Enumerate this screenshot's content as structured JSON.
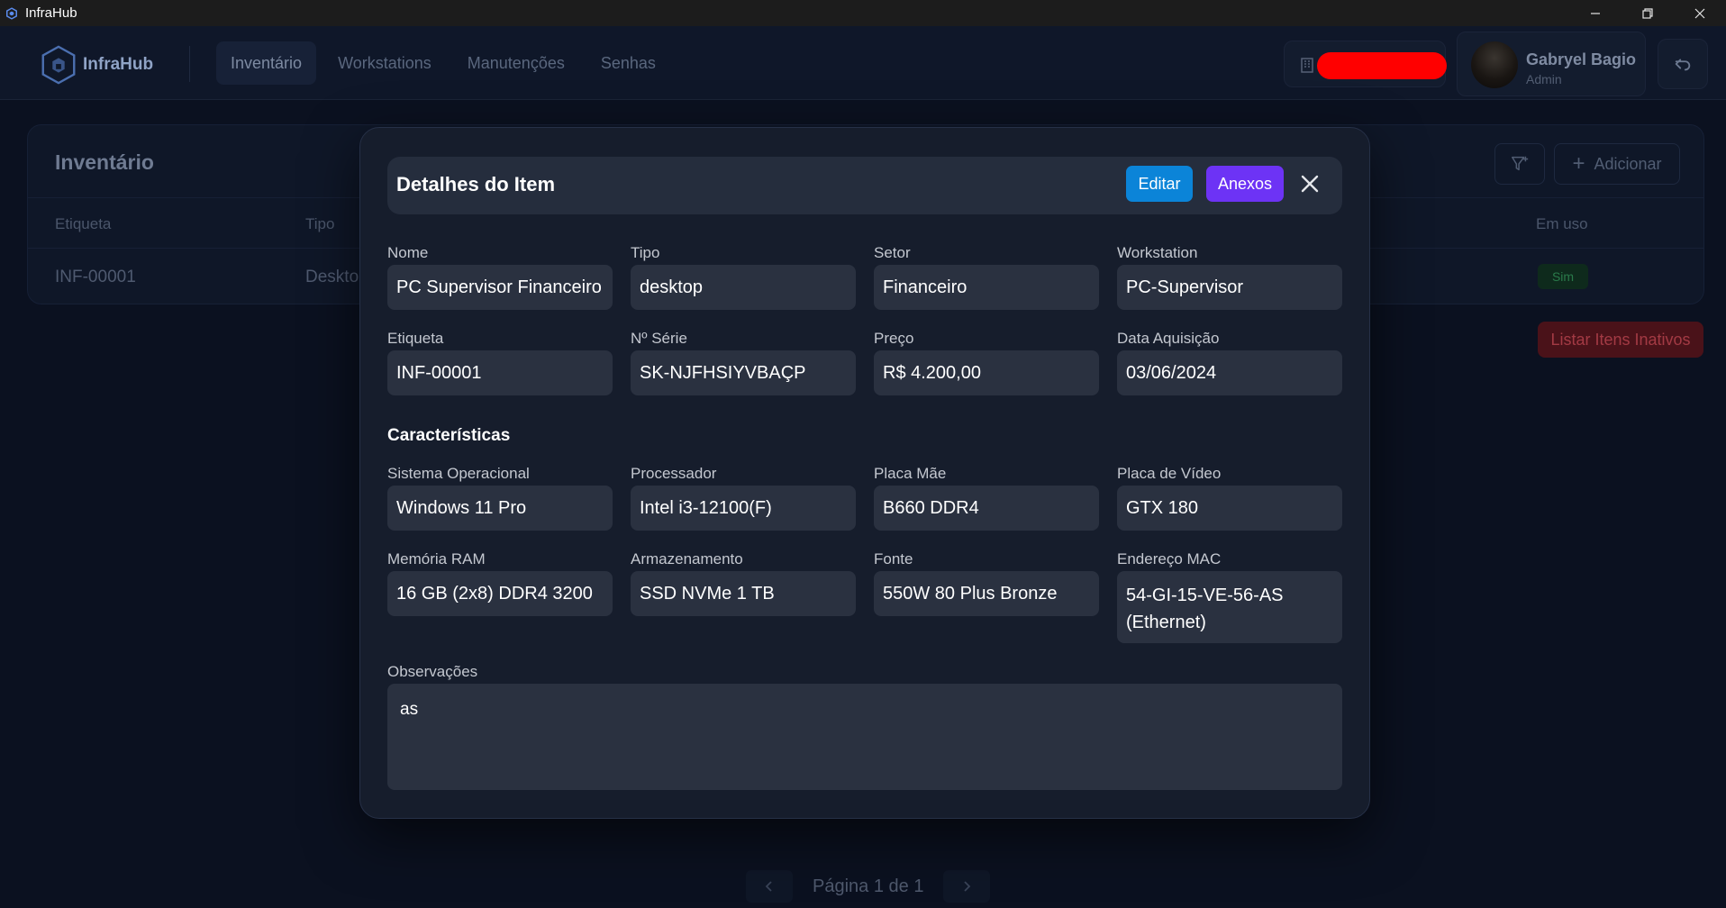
{
  "window": {
    "title": "InfraHub"
  },
  "header": {
    "brand": "InfraHub",
    "nav": [
      "Inventário",
      "Workstations",
      "Manutenções",
      "Senhas"
    ],
    "user": {
      "name": "Gabryel Bagio",
      "role": "Admin"
    }
  },
  "background": {
    "title": "Inventário",
    "add_label": "Adicionar",
    "columns": {
      "etiqueta": "Etiqueta",
      "tipo": "Tipo",
      "em_uso": "Em uso"
    },
    "row": {
      "etiqueta": "INF-00001",
      "tipo": "Deskto",
      "em_uso": "Sim"
    },
    "inactive_button": "Listar Itens Inativos",
    "pagination": "Página 1 de 1"
  },
  "modal": {
    "title": "Detalhes do Item",
    "edit_label": "Editar",
    "attachments_label": "Anexos",
    "fields": [
      {
        "label": "Nome",
        "value": "PC Supervisor Financeiro"
      },
      {
        "label": "Tipo",
        "value": "desktop"
      },
      {
        "label": "Setor",
        "value": "Financeiro"
      },
      {
        "label": "Workstation",
        "value": "PC-Supervisor"
      },
      {
        "label": "Etiqueta",
        "value": "INF-00001"
      },
      {
        "label": "Nº Série",
        "value": "SK-NJFHSIYVBAÇP"
      },
      {
        "label": "Preço",
        "value": "R$ 4.200,00"
      },
      {
        "label": "Data Aquisição",
        "value": "03/06/2024"
      }
    ],
    "characteristics_title": "Características",
    "characteristics": [
      {
        "label": "Sistema Operacional",
        "value": "Windows 11 Pro"
      },
      {
        "label": "Processador",
        "value": "Intel i3-12100(F)"
      },
      {
        "label": "Placa Mãe",
        "value": "B660 DDR4"
      },
      {
        "label": "Placa de Vídeo",
        "value": "GTX 180"
      },
      {
        "label": "Memória RAM",
        "value": "16 GB (2x8) DDR4 3200"
      },
      {
        "label": "Armazenamento",
        "value": "SSD NVMe 1 TB"
      },
      {
        "label": "Fonte",
        "value": "550W 80 Plus Bronze"
      },
      {
        "label": "Endereço MAC",
        "value": "54-GI-15-VE-56-AS (Ethernet)"
      }
    ],
    "notes_label": "Observações",
    "notes_value": "as"
  }
}
